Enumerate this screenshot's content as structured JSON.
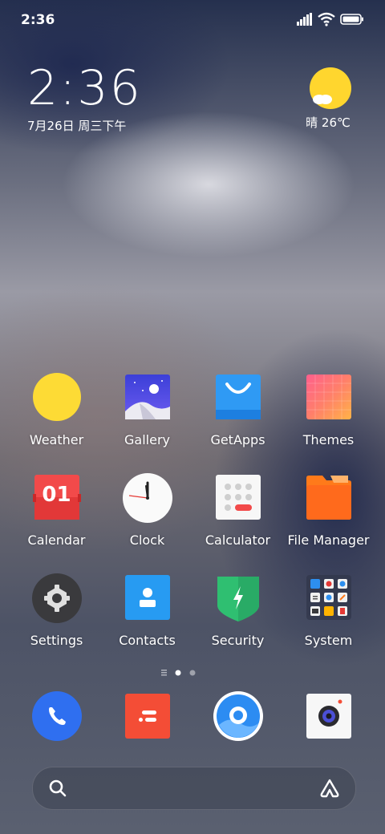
{
  "status_bar": {
    "time": "2:36"
  },
  "clock_widget": {
    "time": "2:36",
    "date": "7月26日 周三下午"
  },
  "weather_widget": {
    "text": "晴 26℃"
  },
  "apps": [
    {
      "label": "Weather"
    },
    {
      "label": "Gallery"
    },
    {
      "label": "GetApps"
    },
    {
      "label": "Themes"
    },
    {
      "label": "Calendar",
      "badge": "01"
    },
    {
      "label": "Clock"
    },
    {
      "label": "Calculator"
    },
    {
      "label": "File Manager"
    },
    {
      "label": "Settings"
    },
    {
      "label": "Contacts"
    },
    {
      "label": "Security"
    },
    {
      "label": "System"
    }
  ],
  "page_indicator": {
    "pages": 2,
    "current": 1
  },
  "dock": [
    {
      "icon": "phone-icon"
    },
    {
      "icon": "messaging-icon"
    },
    {
      "icon": "browser-icon"
    },
    {
      "icon": "camera-icon"
    }
  ],
  "search_bar": {
    "search_icon": "search-icon",
    "assistant_icon": "assistant-icon"
  }
}
